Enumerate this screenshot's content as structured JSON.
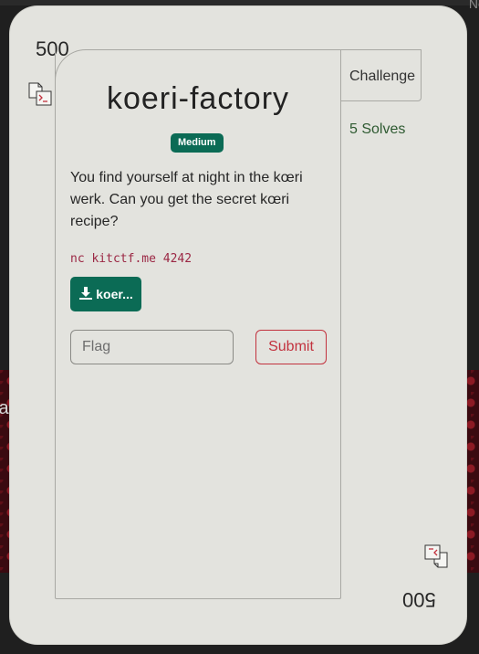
{
  "background": {
    "left_text": "ja",
    "top_right_text": "Nc"
  },
  "card": {
    "points": "500",
    "points_flipped": "500",
    "tab_label": "Challenge",
    "solves": "5 Solves",
    "title": "koeri-factory",
    "difficulty": "Medium",
    "description": "You find yourself at night in the kœri werk. Can you get the secret kœri recipe?",
    "command": "nc kitctf.me 4242",
    "download_label": "koer...",
    "flag_placeholder": "Flag",
    "flag_value": "",
    "submit_label": "Submit"
  },
  "colors": {
    "card_bg": "#e3e3de",
    "accent_green": "#0b6b55",
    "submit_red": "#c2323e",
    "command_text": "#9b2744",
    "solves_text": "#2e5a31"
  },
  "icons": {
    "category": "terminal-file-icon",
    "download": "download-icon"
  }
}
